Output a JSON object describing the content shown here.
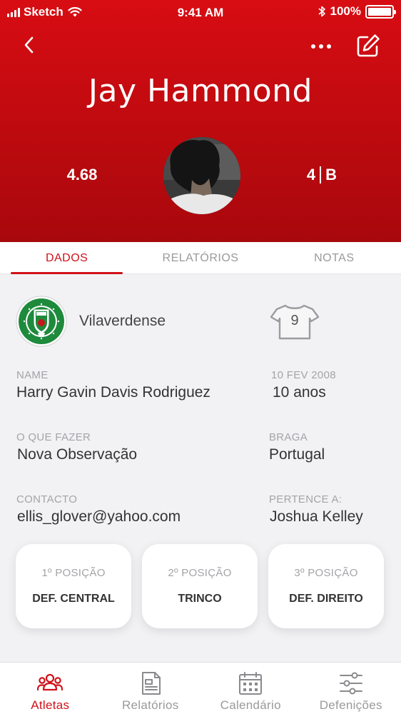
{
  "status_bar": {
    "carrier": "Sketch",
    "time": "9:41 AM",
    "battery": "100%"
  },
  "header": {
    "athlete_name": "Jay Hammond",
    "rating": "4.68",
    "level_number": "4",
    "level_letter": "B"
  },
  "tabs": [
    {
      "label": "DADOS",
      "active": true
    },
    {
      "label": "RELATÓRIOS",
      "active": false
    },
    {
      "label": "NOTAS",
      "active": false
    }
  ],
  "club": {
    "name": "Vilaverdense",
    "shirt_number": "9"
  },
  "fields": {
    "name_label": "NAME",
    "name_value": "Harry Gavin Davis Rodriguez",
    "birth_label": "10 FEV 2008",
    "birth_value": "10 anos",
    "todo_label": "O QUE FAZER",
    "todo_value": "Nova Observação",
    "region_label": "BRAGA",
    "region_value": "Portugal",
    "contact_label": "CONTACTO",
    "contact_value": "ellis_glover@yahoo.com",
    "owner_label": "PERTENCE A:",
    "owner_value": "Joshua Kelley"
  },
  "positions": [
    {
      "title": "1º POSIÇÃO",
      "value": "DEF. CENTRAL"
    },
    {
      "title": "2º POSIÇÃO",
      "value": "TRINCO"
    },
    {
      "title": "3º POSIÇÃO",
      "value": "DEF. DIREITO"
    }
  ],
  "bottom_nav": [
    {
      "label": "Atletas",
      "icon": "users-icon",
      "active": true
    },
    {
      "label": "Relatórios",
      "icon": "document-icon",
      "active": false
    },
    {
      "label": "Calendário",
      "icon": "calendar-icon",
      "active": false
    },
    {
      "label": "Defenições",
      "icon": "sliders-icon",
      "active": false
    }
  ],
  "colors": {
    "brand_red": "#d0111a",
    "header_top": "#d70d13",
    "header_bottom": "#a8080c",
    "club_green": "#1e8a3c"
  }
}
